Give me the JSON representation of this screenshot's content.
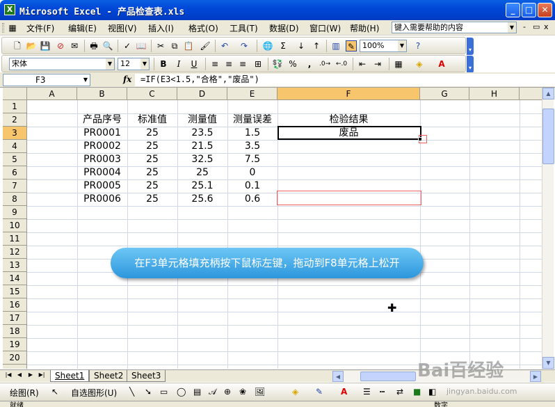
{
  "window": {
    "title": "Microsoft Excel - 产品检查表.xls",
    "minimize": "_",
    "maximize": "□",
    "close": "✕"
  },
  "menubar": {
    "items": [
      "文件(F)",
      "编辑(E)",
      "视图(V)",
      "插入(I)",
      "格式(O)",
      "工具(T)",
      "数据(D)",
      "窗口(W)",
      "帮助(H)"
    ],
    "help_placeholder": "键入需要帮助的内容",
    "mdi_buttons": [
      "-",
      "▭",
      "x"
    ]
  },
  "toolbar": {
    "zoom": "100%",
    "font_name": "宋体",
    "font_size": "12",
    "bold": "B",
    "italic": "I",
    "underline": "U",
    "percent": "%",
    "comma": ",",
    "sigma": "Σ"
  },
  "formula_bar": {
    "cell_ref": "F3",
    "fx": "fx",
    "formula": "=IF(E3<1.5,\"合格\",\"废品\")"
  },
  "sheet": {
    "columns": [
      "A",
      "B",
      "C",
      "D",
      "E",
      "F",
      "G",
      "H"
    ],
    "selected_column": "F",
    "rows": [
      "1",
      "2",
      "3",
      "4",
      "5",
      "6",
      "7",
      "8",
      "9",
      "10",
      "11",
      "12",
      "13",
      "14",
      "15",
      "16",
      "17",
      "18",
      "19",
      "20"
    ],
    "selected_row": "3",
    "headers": {
      "b2": "产品序号",
      "c2": "标准值",
      "d2": "测量值",
      "e2": "测量误差",
      "f2": "检验结果"
    },
    "data": [
      {
        "id": "PR0001",
        "std": "25",
        "meas": "23.5",
        "err": "1.5",
        "result": "废品"
      },
      {
        "id": "PR0002",
        "std": "25",
        "meas": "21.5",
        "err": "3.5",
        "result": ""
      },
      {
        "id": "PR0003",
        "std": "25",
        "meas": "32.5",
        "err": "7.5",
        "result": ""
      },
      {
        "id": "PR0004",
        "std": "25",
        "meas": "25",
        "err": "0",
        "result": ""
      },
      {
        "id": "PR0005",
        "std": "25",
        "meas": "25.1",
        "err": "0.1",
        "result": ""
      },
      {
        "id": "PR0006",
        "std": "25",
        "meas": "25.6",
        "err": "0.6",
        "result": ""
      }
    ]
  },
  "callout": "在F3单元格填充柄按下鼠标左键，拖动到F8单元格上松开",
  "sheet_tabs": [
    "Sheet1",
    "Sheet2",
    "Sheet3"
  ],
  "draw_toolbar": {
    "draw": "绘图(R)",
    "autoshapes": "自选图形(U)"
  },
  "status": {
    "left": "就绪",
    "right": "数字"
  },
  "watermark": {
    "brand": "Bai百经验",
    "url": "jingyan.baidu.com"
  }
}
